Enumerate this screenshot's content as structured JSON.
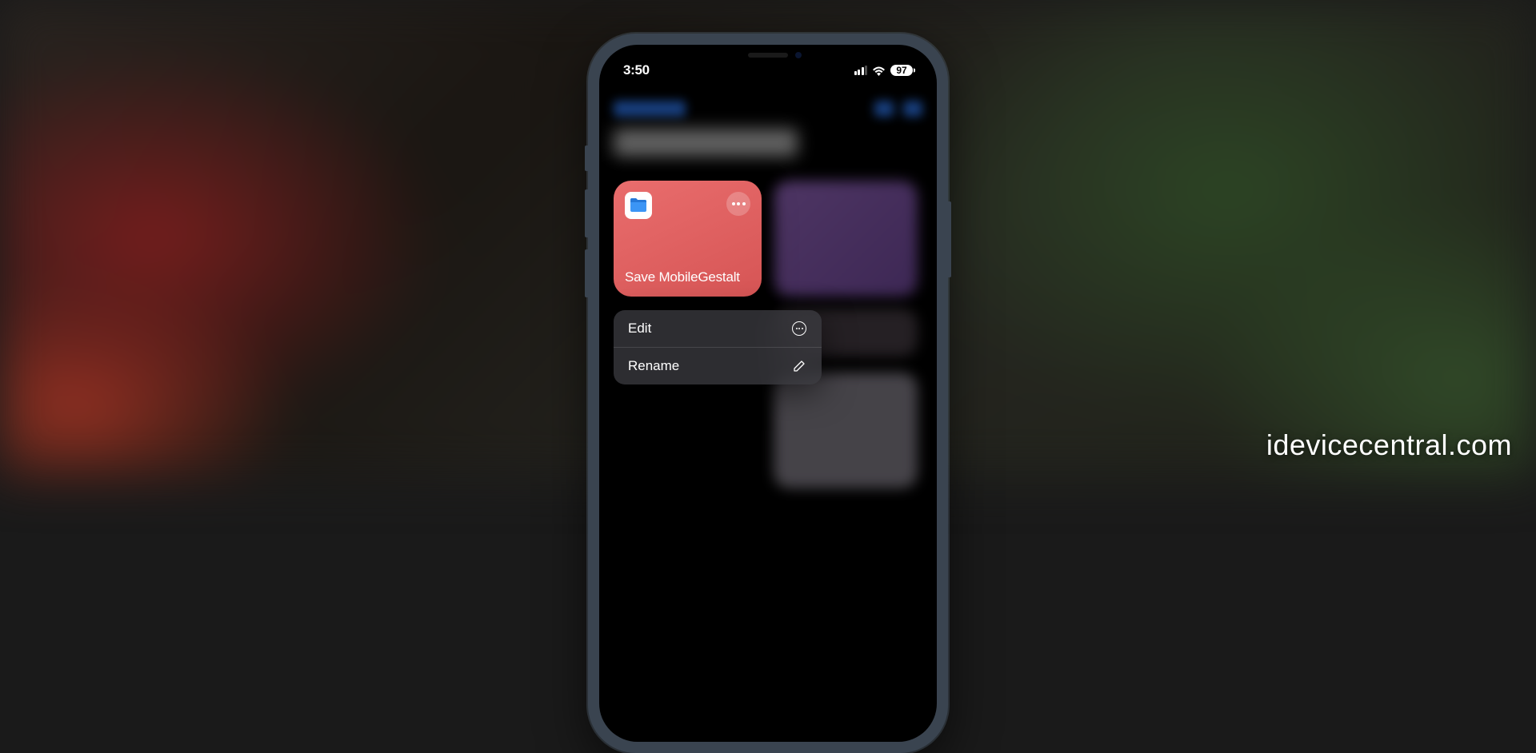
{
  "watermark": "idevicecentral.com",
  "status_bar": {
    "time": "3:50",
    "battery": "97"
  },
  "shortcut": {
    "title": "Save MobileGestalt",
    "icon_name": "files-folder-icon"
  },
  "context_menu": {
    "items": [
      {
        "label": "Edit",
        "icon": "more-circle-icon"
      },
      {
        "label": "Rename",
        "icon": "pencil-icon"
      }
    ]
  },
  "colors": {
    "tile_gradient_start": "#e96d6d",
    "tile_gradient_end": "#d65555",
    "accent_blue": "#2868d0"
  }
}
